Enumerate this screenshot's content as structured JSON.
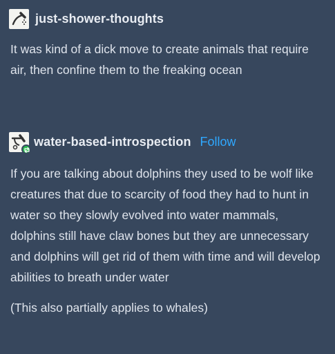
{
  "posts": [
    {
      "username": "just-shower-thoughts",
      "avatar_icon": "shower-head-icon",
      "body": "It was kind of a dick move to create animals that require air, then confine them to the freaking ocean"
    },
    {
      "username": "water-based-introspection",
      "avatar_icon": "shower-head-icon",
      "badge_icon": "reblog-icon",
      "follow_label": "Follow",
      "body": "If you are talking about dolphins they used to be wolf like creatures that due to scarcity of food they had to hunt in water so they slowly evolved into water mammals, dolphins still have claw bones but they are unnecessary and dolphins will get rid of them with time and will develop abilities to breath under water",
      "note": "(This also partially applies to whales)"
    }
  ],
  "colors": {
    "background": "#37475d",
    "text": "#dfe4ec",
    "follow": "#2fa8ff",
    "badge": "#2dbb52"
  }
}
